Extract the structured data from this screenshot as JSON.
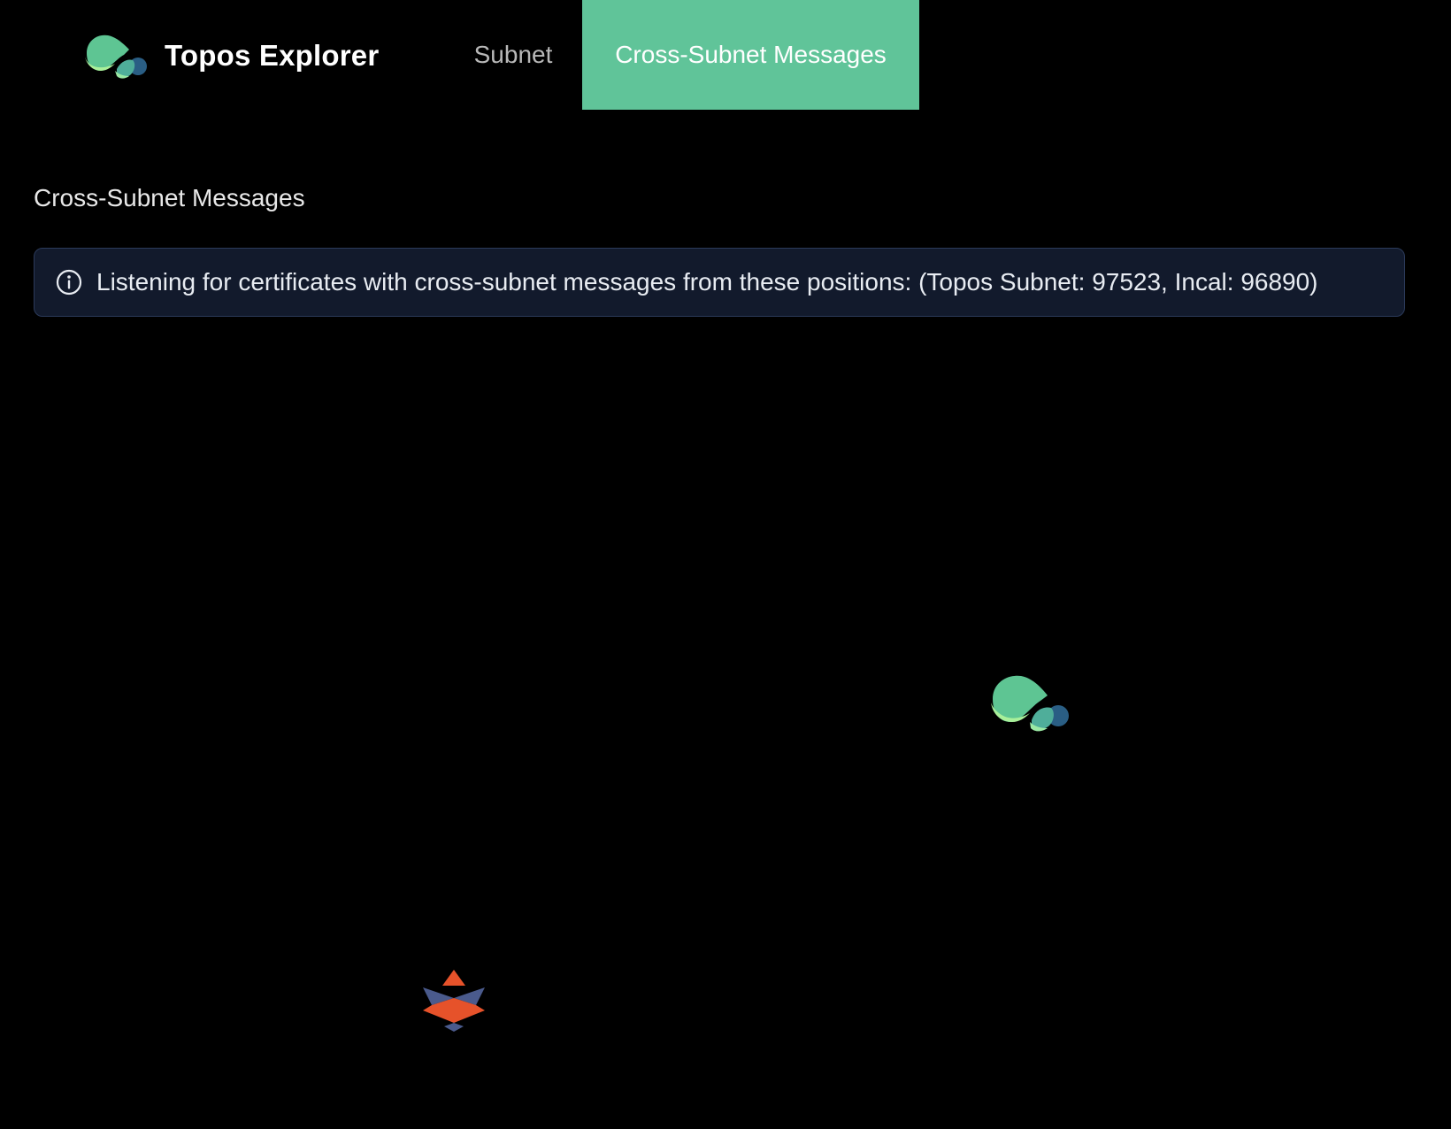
{
  "header": {
    "brand_name": "Topos Explorer",
    "logo_icon": "topos-logo-icon",
    "nav": [
      {
        "label": "Subnet",
        "active": false
      },
      {
        "label": "Cross-Subnet Messages",
        "active": true
      }
    ],
    "active_tab_color": "#60c499"
  },
  "main": {
    "title": "Cross-Subnet Messages",
    "alert": {
      "icon": "info-icon",
      "text": "Listening for certificates with cross-subnet messages from these positions: (Topos Subnet: 97523, Incal: 96890)"
    },
    "graph": {
      "nodes": [
        {
          "name": "Topos Subnet",
          "icon": "topos-logo-icon"
        },
        {
          "name": "Incal",
          "icon": "incal-logo-icon"
        }
      ]
    }
  },
  "colors": {
    "background": "#000000",
    "accent": "#60c499",
    "alert_bg": "#121a2c",
    "alert_border": "#2b3a5a",
    "incal_orange": "#e6522a",
    "incal_blue": "#4a5a8c"
  }
}
